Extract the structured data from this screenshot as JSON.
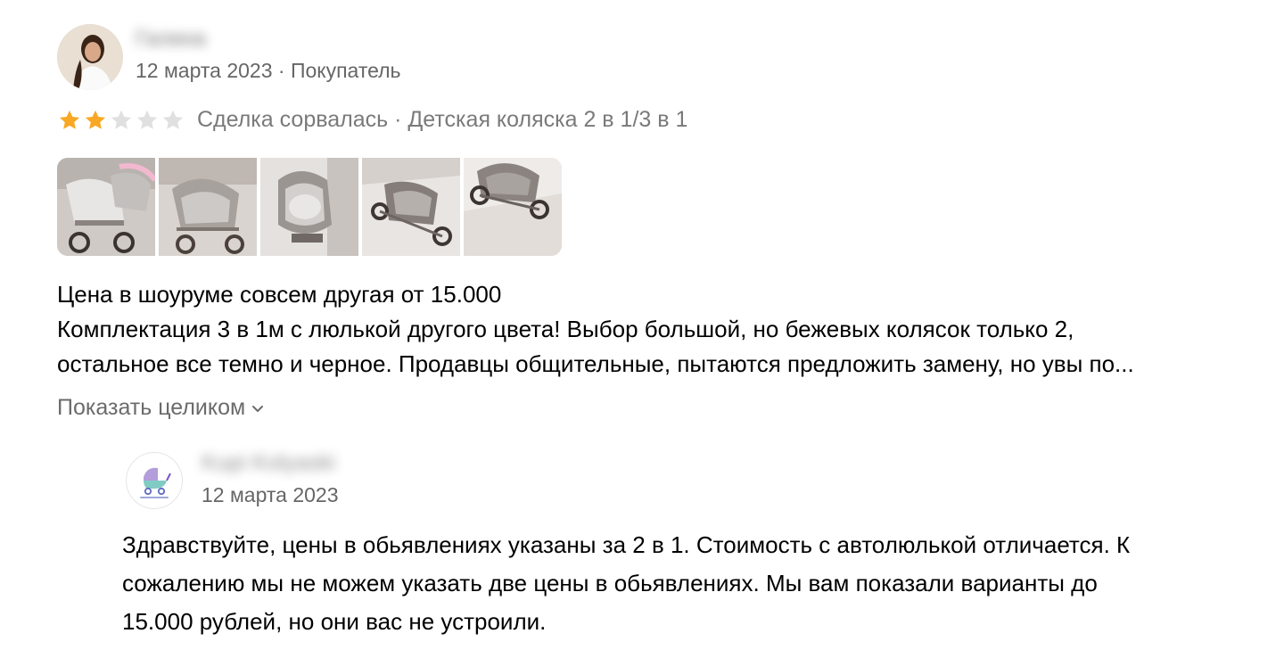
{
  "review": {
    "author": {
      "name": "Галина",
      "avatar_icon": "user-avatar-photo",
      "date": "12 марта 2023",
      "separator": " · ",
      "role": "Покупатель"
    },
    "rating": {
      "stars_filled": 2,
      "stars_total": 5,
      "star_filled_color": "#f9a825",
      "star_empty_color": "#e0e0e0",
      "status": "Сделка сорвалась",
      "separator": " · ",
      "item": "Детская коляска 2 в 1/3 в 1"
    },
    "photos": [
      {
        "icon": "stroller-photo-1"
      },
      {
        "icon": "stroller-photo-2"
      },
      {
        "icon": "stroller-photo-3"
      },
      {
        "icon": "stroller-photo-4"
      },
      {
        "icon": "stroller-photo-5"
      }
    ],
    "text_lines": [
      "Цена в шоуруме совсем другая от 15.000",
      "Комплектация 3 в 1м с люлькой другого цвета! Выбор большой, но бежевых колясок только 2,",
      "остальное все темно и черное. Продавцы общительные, пытаются предложить замену, но увы по..."
    ],
    "show_more_label": "Показать целиком",
    "show_more_icon": "chevron-down-icon"
  },
  "reply": {
    "seller_name": "Kupi Kolyaski",
    "seller_avatar_icon": "stroller-logo-icon",
    "date": "12 марта 2023",
    "text_lines": [
      "Здравствуйте, цены в обьявлениях указаны за 2 в 1. Стоимость с автолюлькой отличается. К",
      "сожалению мы не можем указать две цены в обьявлениях. Мы вам показали варианты до",
      "15.000 рублей, но они вас не устроили."
    ]
  }
}
